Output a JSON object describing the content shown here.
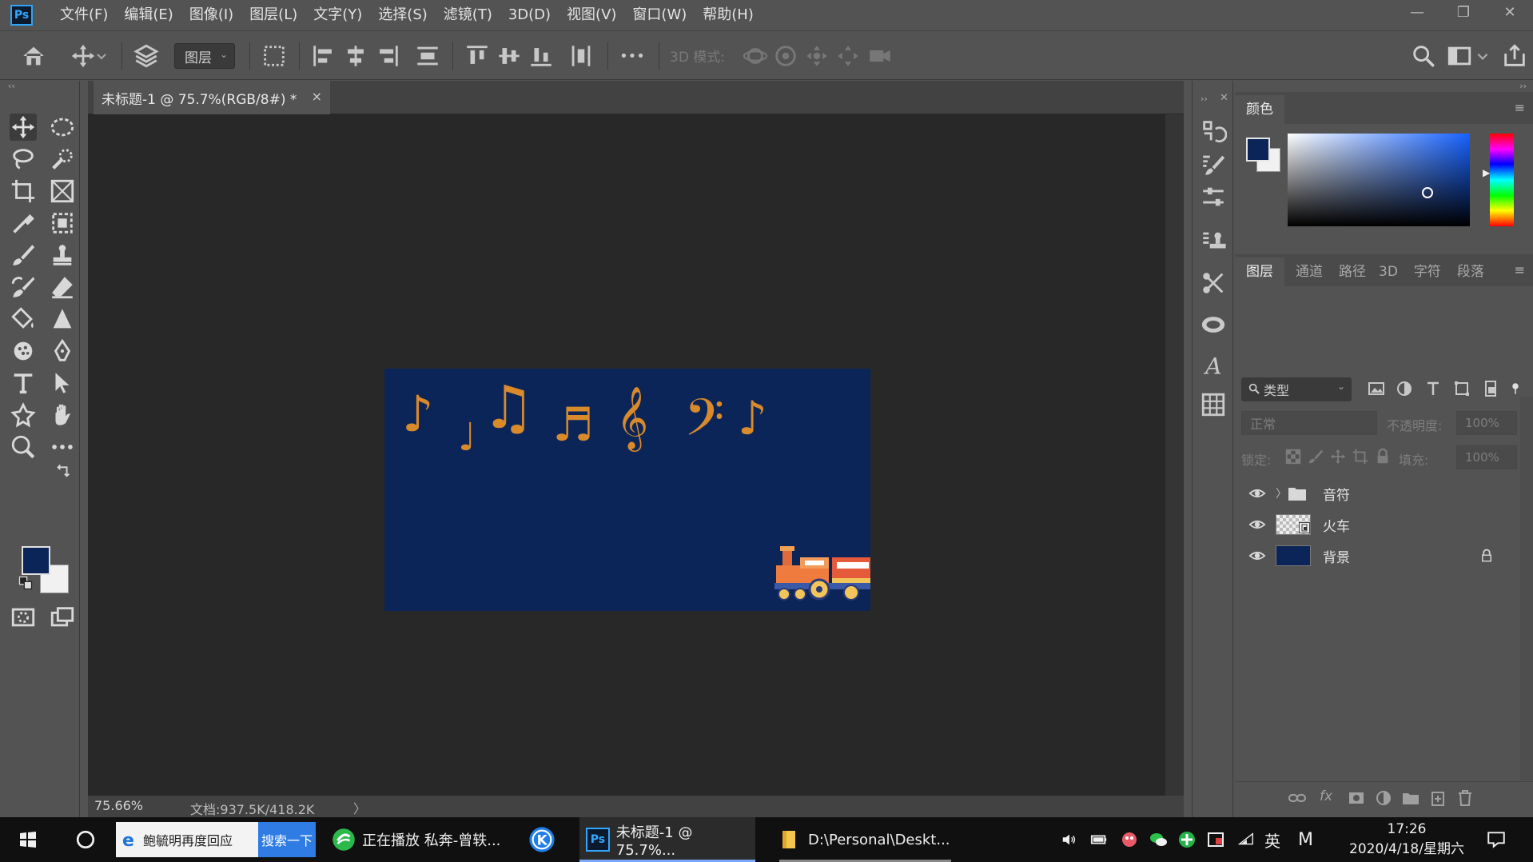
{
  "app": {
    "logo_text": "Ps"
  },
  "menubar": {
    "items": [
      "文件(F)",
      "编辑(E)",
      "图像(I)",
      "图层(L)",
      "文字(Y)",
      "选择(S)",
      "滤镜(T)",
      "3D(D)",
      "视图(V)",
      "窗口(W)",
      "帮助(H)"
    ]
  },
  "window_controls": {
    "minimize": "—",
    "restore": "❐",
    "close": "✕"
  },
  "options": {
    "auto_select_target": "图层",
    "mode_3d_label": "3D 模式:",
    "more": "•••"
  },
  "document": {
    "tab_title": "未标题-1 @ 75.7%(RGB/8#) *",
    "close": "×",
    "zoom": "75.66%",
    "doc_size": "文档:937.5K/418.2K",
    "status_arrow": "〉",
    "artboard_color": "#0c2558",
    "note_color": "#d98a2b",
    "music_symbols": [
      "♪",
      "♩",
      "♫",
      "♬",
      "𝄞",
      "𝄢",
      "♪"
    ]
  },
  "swatches": {
    "foreground": "#0c2558",
    "background": "#f1f1f1"
  },
  "color_panel": {
    "tab": "颜色",
    "menu": "≡"
  },
  "layers_panel": {
    "tabs": [
      "图层",
      "通道",
      "路径",
      "3D",
      "字符",
      "段落"
    ],
    "menu": "≡",
    "filter_label": "类型",
    "blend_mode": "正常",
    "opacity_label": "不透明度:",
    "opacity_value": "100%",
    "lock_label": "锁定:",
    "fill_label": "填充:",
    "fill_value": "100%",
    "layers": [
      {
        "name": "音符",
        "type": "group",
        "expand": "〉"
      },
      {
        "name": "火车",
        "type": "smart"
      },
      {
        "name": "背景",
        "type": "background",
        "color": "#0c2558"
      }
    ],
    "bottom_fx": "fx"
  },
  "taskbar": {
    "search_text": "鲍毓明再度回应",
    "search_button": "搜索一下",
    "music_app": "正在播放 私奔-曾轶...",
    "ps_window": "未标题-1 @ 75.7%...",
    "folder_window": "D:\\Personal\\Deskt...",
    "ime": "英",
    "ime2": "M",
    "time": "17:26",
    "date": "2020/4/18/星期六"
  }
}
